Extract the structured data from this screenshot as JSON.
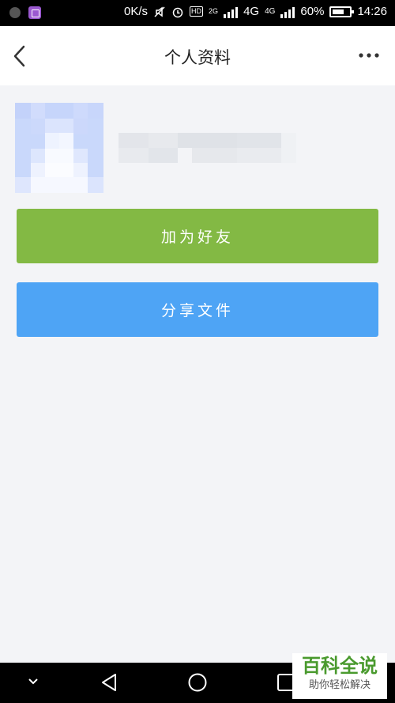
{
  "status_bar": {
    "speed": "0K/s",
    "network_a": "4G",
    "network_b": "4G",
    "network_small": "2G",
    "hd_badge": "HD",
    "battery": "60%",
    "time": "14:26"
  },
  "header": {
    "title": "个人资料"
  },
  "profile": {
    "avatar_icon": "avatar-blurred",
    "name_icon": "name-blurred"
  },
  "actions": {
    "add_friend": "加为好友",
    "share_file": "分享文件"
  },
  "watermark": {
    "title": "百科全说",
    "subtitle": "助你轻松解决"
  },
  "colors": {
    "add_button": "#83b944",
    "share_button": "#4ea4f5",
    "background": "#f3f4f7"
  }
}
